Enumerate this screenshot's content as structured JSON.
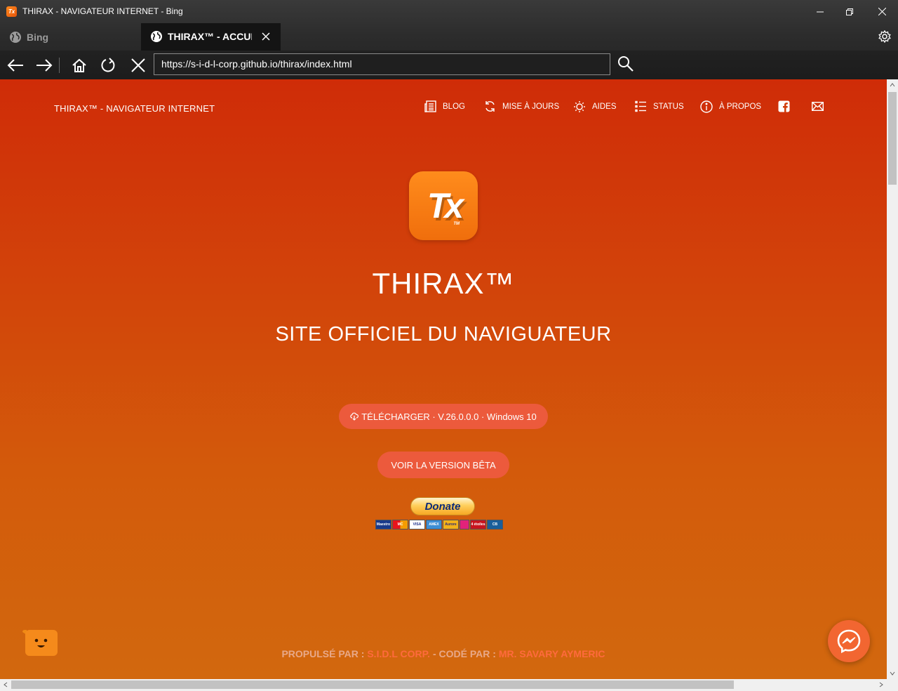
{
  "window": {
    "title": "THIRAX - NAVIGATEUR INTERNET - Bing",
    "app_icon_text": "Tx"
  },
  "tabs": [
    {
      "label": "Bing",
      "active": false
    },
    {
      "label": "THIRAX™ - ACCUEIL",
      "active": true
    }
  ],
  "address_bar": {
    "url": "https://s-i-d-l-corp.github.io/thirax/index.html"
  },
  "site": {
    "brand": "THIRAX™ - NAVIGATEUR INTERNET",
    "nav": [
      {
        "label": "BLOG",
        "icon": "newspaper-icon"
      },
      {
        "label": "MISE À JOURS",
        "icon": "refresh-icon"
      },
      {
        "label": "AIDES",
        "icon": "lightbulb-icon"
      },
      {
        "label": "STATUS",
        "icon": "list-icon"
      },
      {
        "label": "À PROPOS",
        "icon": "info-icon"
      }
    ],
    "social": [
      "facebook-icon",
      "mail-icon"
    ],
    "logo_text": "Tx",
    "logo_tm": "TM",
    "hero_title": "THIRAX™",
    "hero_subtitle": "SITE OFFICIEL DU NAVIGUATEUR",
    "download_button": "TÉLÉCHARGER · V.26.0.0.0 · Windows 10",
    "beta_button": "VOIR LA VERSION BÊTA",
    "donate_button": "Donate",
    "payment_cards": [
      "Maestro",
      "MC",
      "VISA",
      "AMEX",
      "Aurore",
      "CB",
      "4 étoiles",
      "CB"
    ],
    "footer": {
      "powered_label": "PROPULSÉ PAR : ",
      "powered_value": "S.I.D.L CORP.",
      "coded_label": " - CODÉ PAR : ",
      "coded_value": "MR. SAVARY AYMERIC"
    }
  },
  "colors": {
    "accent": "#ec5a3c",
    "background_top": "#cf2c08",
    "background_bottom": "#d2680e",
    "footer_highlight": "#ff6a3d"
  }
}
